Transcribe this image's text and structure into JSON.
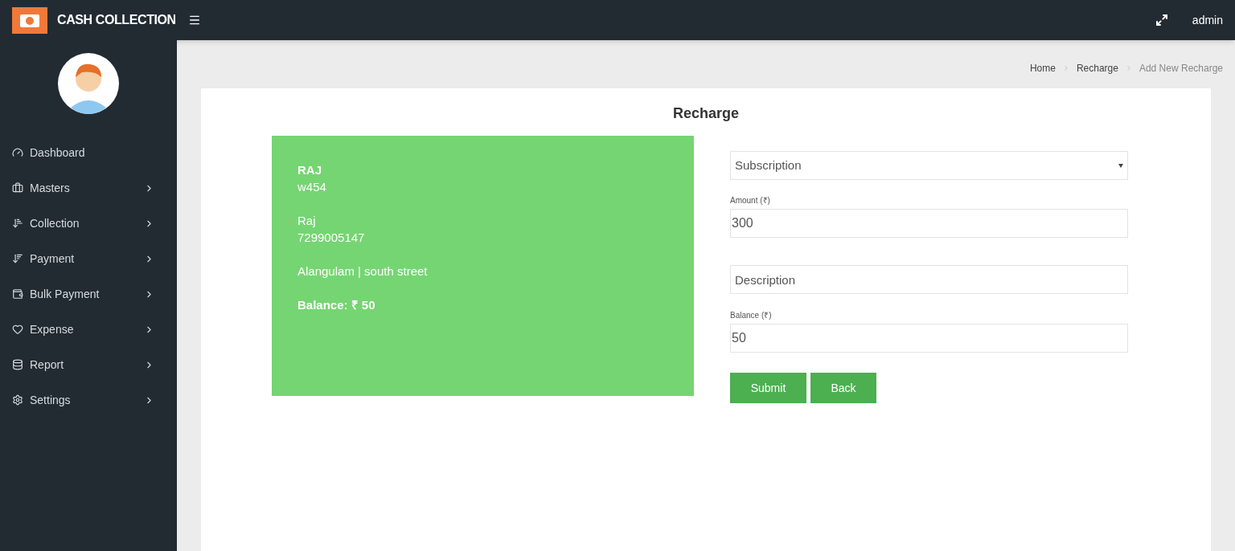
{
  "header": {
    "app_name": "CASH COLLECTION",
    "user": "admin"
  },
  "sidebar": {
    "items": [
      {
        "label": "Dashboard",
        "has_submenu": false
      },
      {
        "label": "Masters",
        "has_submenu": true
      },
      {
        "label": "Collection",
        "has_submenu": true
      },
      {
        "label": "Payment",
        "has_submenu": true
      },
      {
        "label": "Bulk Payment",
        "has_submenu": true
      },
      {
        "label": "Expense",
        "has_submenu": true
      },
      {
        "label": "Report",
        "has_submenu": true
      },
      {
        "label": "Settings",
        "has_submenu": true
      }
    ]
  },
  "breadcrumb": [
    {
      "label": "Home",
      "current": false
    },
    {
      "label": "Recharge",
      "current": false
    },
    {
      "label": "Add New Recharge",
      "current": true
    }
  ],
  "page_title": "Recharge",
  "customer_card": {
    "name": "RAJ",
    "code": "w454",
    "contact_name": "Raj",
    "phone": "7299005147",
    "address": "Alangulam | south street",
    "balance": "Balance: ₹ 50"
  },
  "form": {
    "plan_select": {
      "value": "Subscription"
    },
    "amount": {
      "label": "Amount (₹)",
      "value": "300"
    },
    "description": {
      "placeholder": "Description"
    },
    "balance": {
      "label": "Balance (₹)",
      "value": "50"
    }
  },
  "buttons": [
    "Submit",
    "Back"
  ]
}
